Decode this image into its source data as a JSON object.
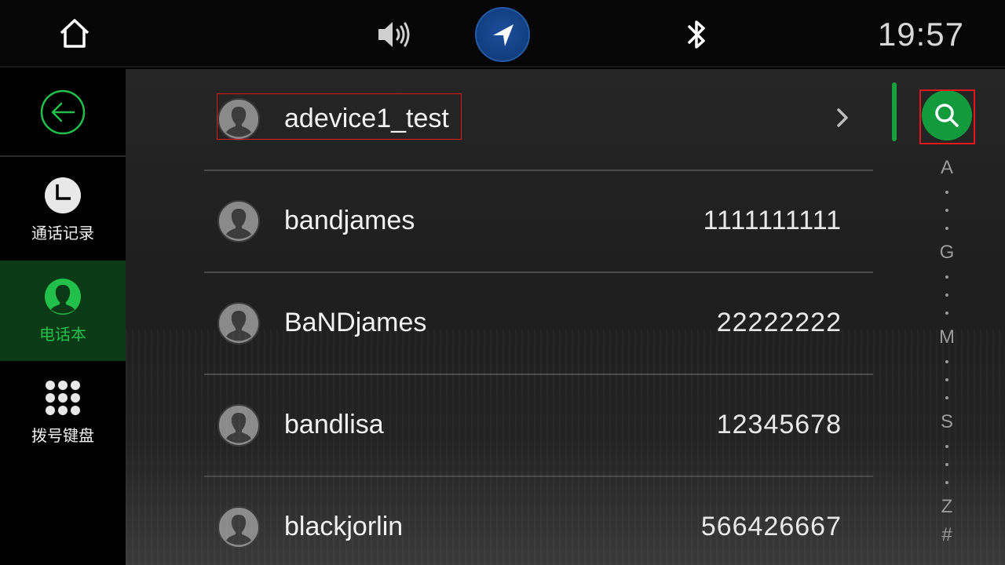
{
  "statusbar": {
    "time": "19:57",
    "icons": [
      "home-icon",
      "volume-icon",
      "navigation-icon",
      "bluetooth-icon"
    ],
    "nav_color": "#123d80"
  },
  "sidebar": {
    "items": [
      {
        "id": "back",
        "icon": "back-arrow-icon",
        "label": ""
      },
      {
        "id": "calls",
        "icon": "clock-icon",
        "label": "通话记录"
      },
      {
        "id": "contacts",
        "icon": "contact-icon",
        "label": "电话本",
        "selected": true
      },
      {
        "id": "dialpad",
        "icon": "dialpad-icon",
        "label": "拨号键盘"
      }
    ],
    "accent": "#22c04a"
  },
  "contacts": [
    {
      "name": "adevice1_test",
      "number": "",
      "has_chevron": true
    },
    {
      "name": "bandjames",
      "number": "1111111111"
    },
    {
      "name": "BaNDjames",
      "number": "22222222"
    },
    {
      "name": "bandlisa",
      "number": "12345678"
    },
    {
      "name": "blackjorlin",
      "number": "566426667"
    }
  ],
  "index": [
    "A",
    "G",
    "M",
    "S",
    "Z",
    "#"
  ],
  "search": {
    "icon": "search-icon",
    "color": "#139a3c"
  }
}
